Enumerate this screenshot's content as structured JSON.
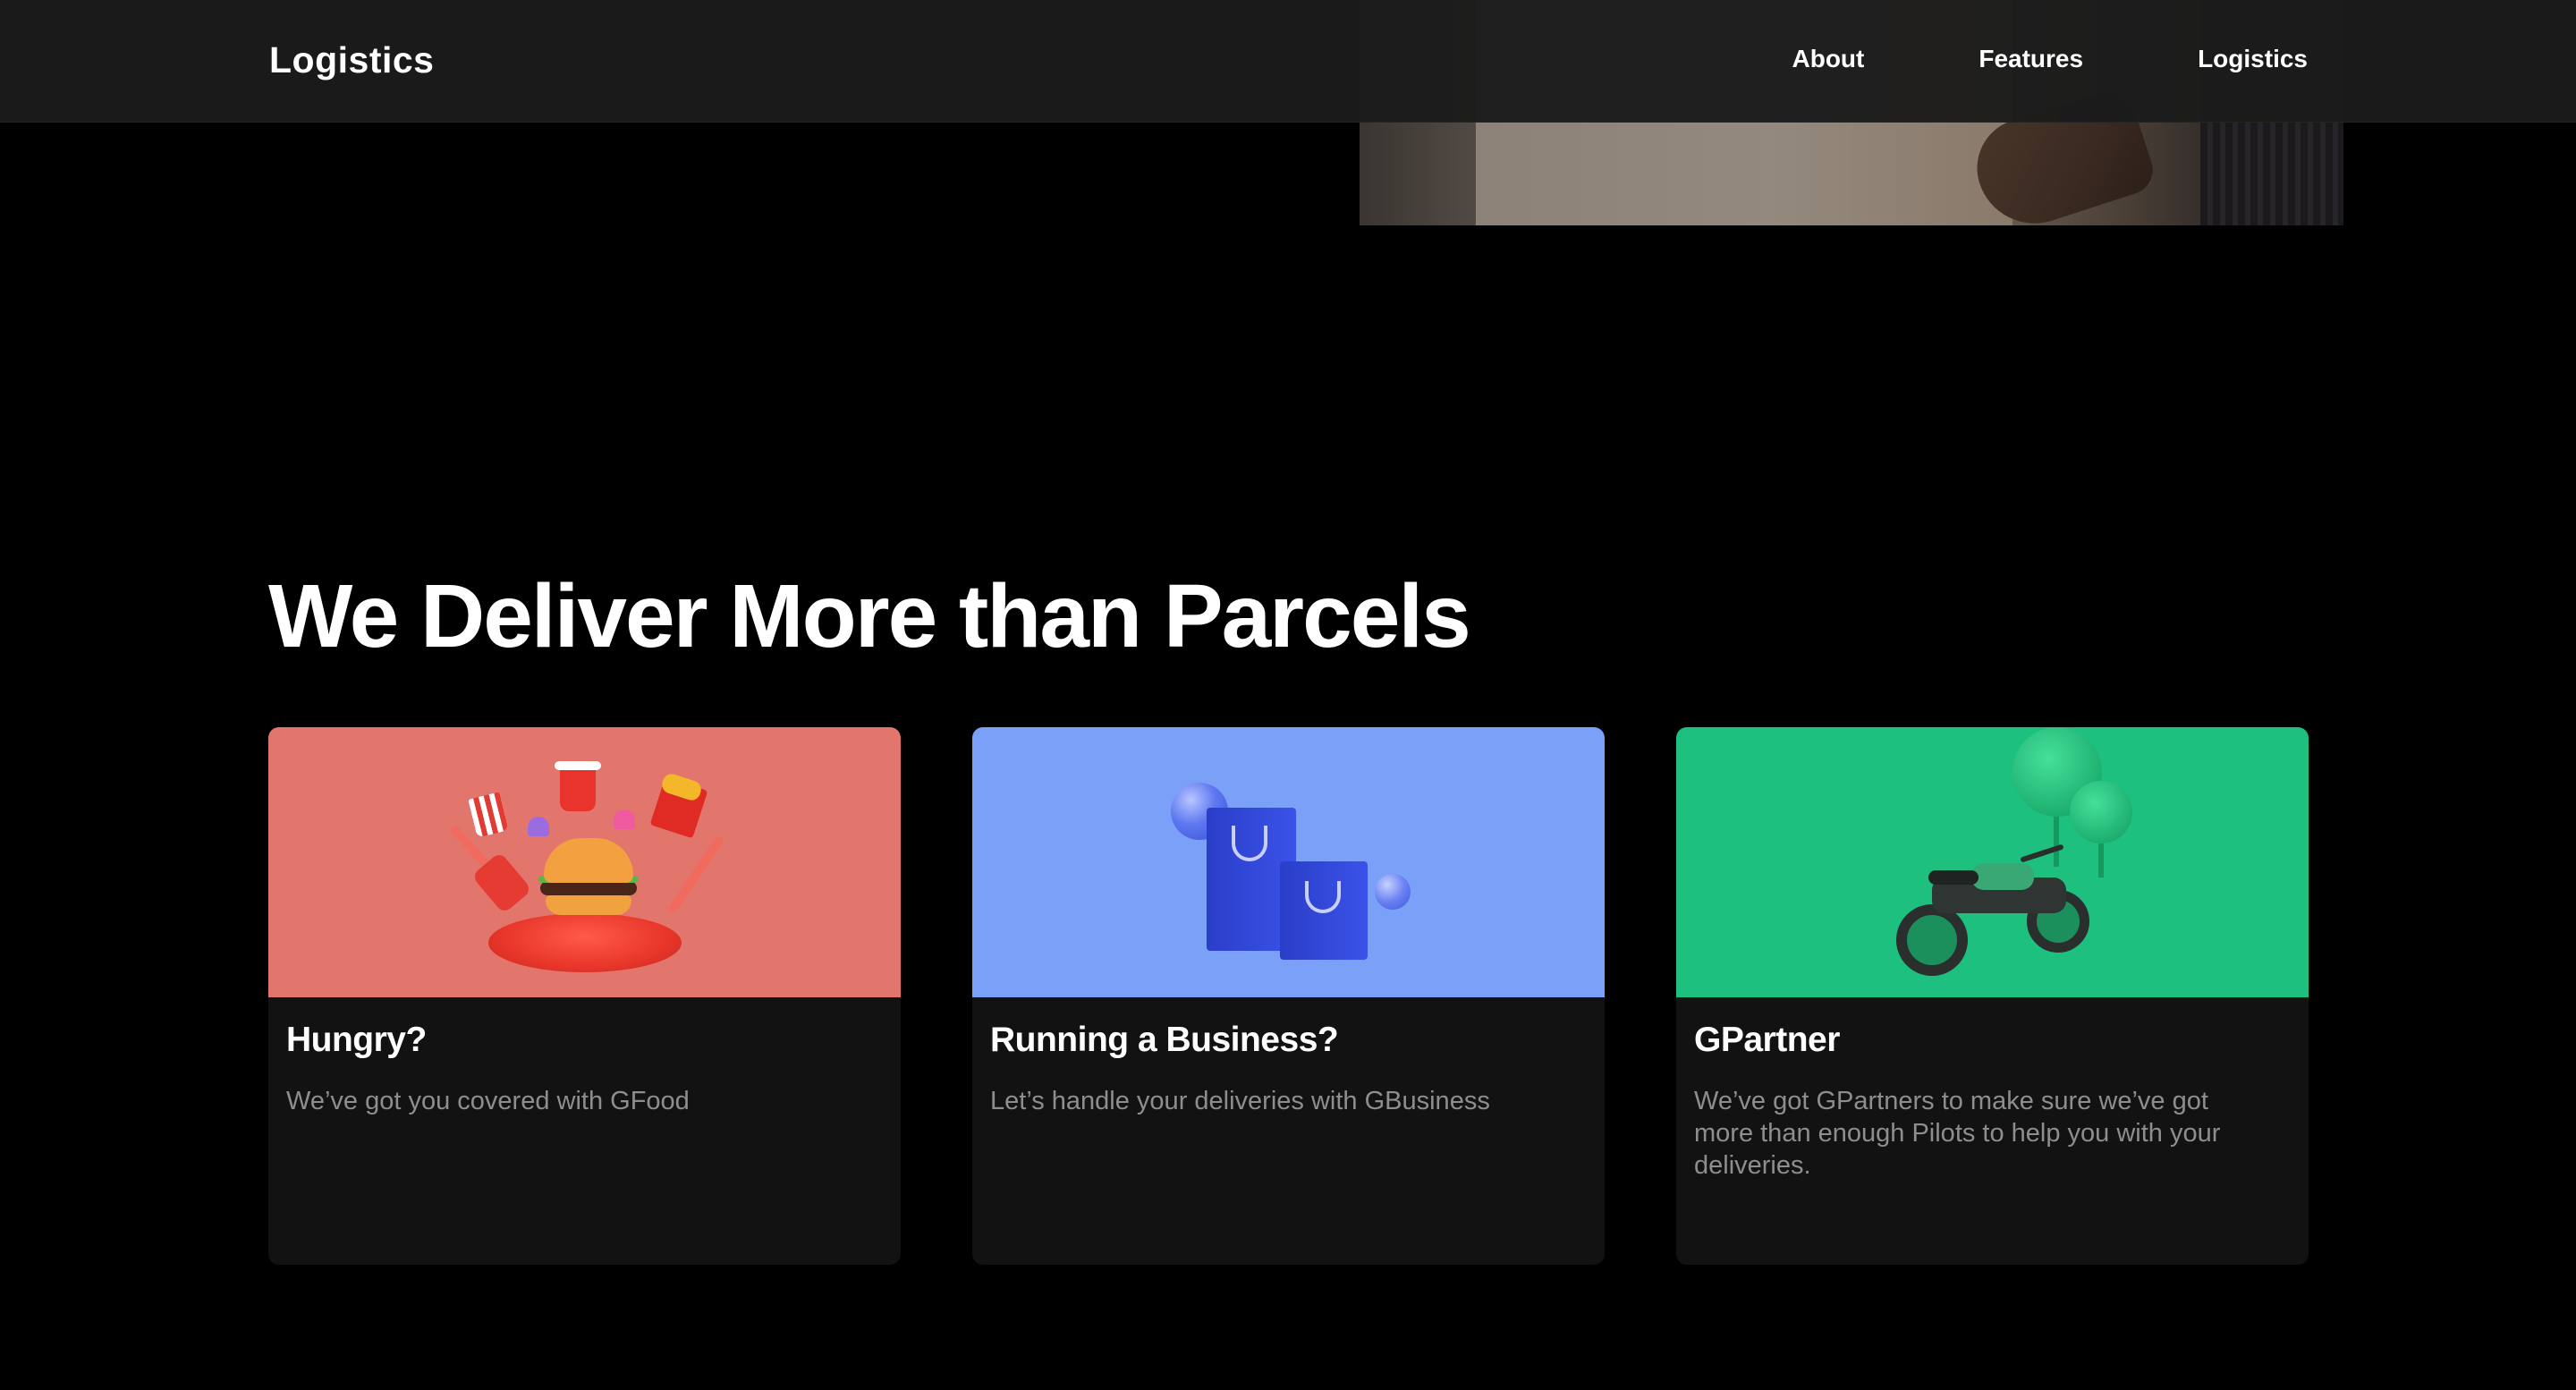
{
  "nav": {
    "brand": "Logistics",
    "links": [
      {
        "label": "About"
      },
      {
        "label": "Features"
      },
      {
        "label": "Logistics"
      }
    ]
  },
  "section": {
    "title": "We Deliver More than Parcels",
    "cards": [
      {
        "title": "Hungry?",
        "description": "We’ve got you covered with GFood",
        "illustration": "food-illustration",
        "color": "#e2766c"
      },
      {
        "title": "Running a Business?",
        "description": "Let’s handle your deliveries with GBusiness",
        "illustration": "shopping-bags-illustration",
        "color": "#7aa0f8"
      },
      {
        "title": "GPartner",
        "description": "We’ve got GPartners to make sure we’ve got more than enough Pilots to help you with your deliveries.",
        "illustration": "motorcycle-illustration",
        "color": "#1dc07e"
      }
    ]
  },
  "colors": {
    "background": "#000000",
    "nav_background": "#1b1b1b",
    "card_background": "#121212",
    "muted_text": "#8e8e8e"
  }
}
